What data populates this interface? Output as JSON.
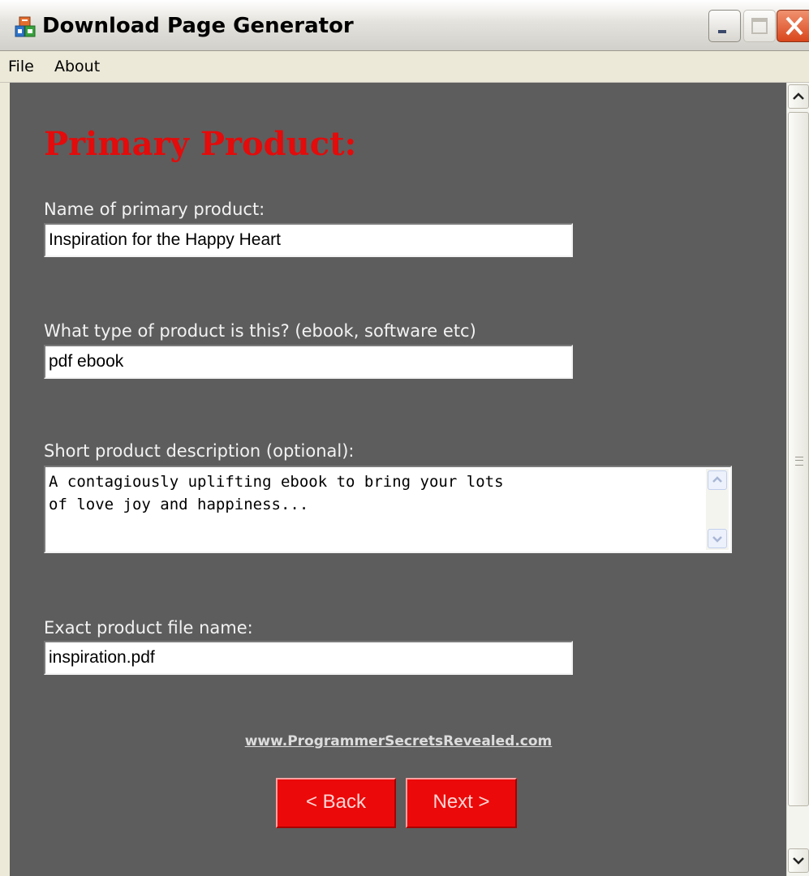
{
  "window": {
    "title": "Download Page Generator",
    "controls": {
      "minimize": "minimize",
      "maximize": "maximize",
      "close": "close"
    }
  },
  "menu": [
    "File",
    "About"
  ],
  "content": {
    "heading": "Primary Product:",
    "fields": {
      "name": {
        "label": "Name of primary product:",
        "value": "Inspiration for the Happy Heart"
      },
      "type": {
        "label": "What type of product is this? (ebook, software etc)",
        "value": "pdf ebook"
      },
      "description": {
        "label": "Short product description (optional):",
        "value": "A contagiously uplifting ebook to bring your lots\nof love joy and happiness..."
      },
      "filename": {
        "label": "Exact product file name:",
        "value": "inspiration.pdf"
      }
    },
    "link": "www.ProgrammerSecretsRevealed.com",
    "buttons": {
      "back": "< Back",
      "next": "Next >"
    }
  },
  "colors": {
    "background": "#5d5d5d",
    "accent": "#e30b0b",
    "button": "#ec0909"
  },
  "icons": {
    "app": "app-window-icon",
    "scroll_up": "chevron-up-icon",
    "scroll_down": "chevron-down-icon"
  }
}
